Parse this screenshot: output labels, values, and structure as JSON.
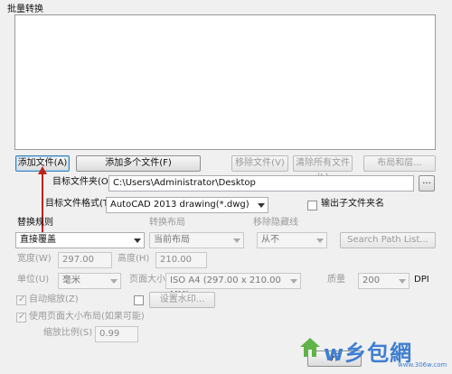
{
  "window": {
    "title": "批量转换"
  },
  "buttons": {
    "add_file": "添加文件(A)",
    "add_multiple": "添加多个文件(F)",
    "remove_file": "移除文件(V)",
    "clear_all": "清除所有文件(L)",
    "layout": "布局和层...",
    "browse": "...",
    "search_path": "Search Path List...",
    "watermark": "设置水印...",
    "start": "开"
  },
  "target_folder": {
    "label": "目标文件夹(O)",
    "value": "C:\\Users\\Administrator\\Desktop"
  },
  "target_format": {
    "label": "目标文件格式(T)",
    "value": "AutoCAD 2013 drawing(*.dwg)"
  },
  "output_subfolder": {
    "label": "输出子文件夹名"
  },
  "replace_rule": {
    "label": "替换规则",
    "value": "直接覆盖"
  },
  "convert_layout": {
    "label": "转换布局",
    "value": "当前布局"
  },
  "remove_hidden": {
    "label": "移除隐藏线",
    "value": "从不"
  },
  "width": {
    "label": "宽度(W)",
    "value": "297.00"
  },
  "height": {
    "label": "高度(H)",
    "value": "210.00"
  },
  "unit": {
    "label": "单位(U)",
    "value": "毫米"
  },
  "page_size": {
    "label": "页面大小",
    "value": "ISO A4 (297.00 x 210.00 MM)"
  },
  "quality": {
    "label": "质量",
    "value": "200",
    "unit": "DPI"
  },
  "auto_scale": {
    "label": "自动缩放(Z)"
  },
  "use_page_layout": {
    "label": "使用页面大小布局(如果可能)"
  },
  "scale_ratio": {
    "label": "缩放比例(S)",
    "value": "0.99"
  },
  "watermark_brand": {
    "text": "w乡包網",
    "url": "www.306w.com"
  }
}
